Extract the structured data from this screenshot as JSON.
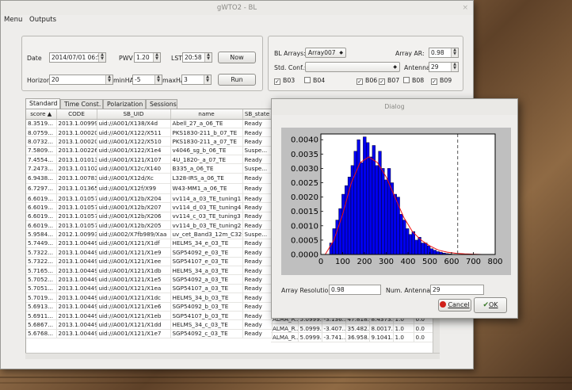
{
  "window": {
    "title": "gWTO2 - BL",
    "close": "×"
  },
  "menu": [
    "Menu",
    "Outputs"
  ],
  "params": {
    "date_label": "Date",
    "date_value": "2014/07/01 06:52",
    "pwv_label": "PWV",
    "pwv_value": "1.20",
    "lst_label": "LST",
    "lst_value": "20:58",
    "now_button": "Now",
    "horizon_label": "Horizon",
    "horizon_value": "20",
    "minha_label": "minHA",
    "minha_value": "-5",
    "maxha_label": "maxHA",
    "maxha_value": "3",
    "run_button": "Run"
  },
  "arrays": {
    "bl_arrays_label": "BL Arrays:",
    "bl_arrays_value": "Array007",
    "array_ar_label": "Array AR:",
    "array_ar_value": "0.98",
    "std_conf_label": "Std. Conf.:",
    "std_conf_value": "",
    "antennas_label": "Antennas:",
    "antennas_value": "29",
    "bands": [
      {
        "label": "B03",
        "checked": true
      },
      {
        "label": "B04",
        "checked": false
      },
      {
        "label": "B06",
        "checked": true
      },
      {
        "label": "B07",
        "checked": true
      },
      {
        "label": "B08",
        "checked": false
      },
      {
        "label": "B09",
        "checked": true
      }
    ]
  },
  "tabs": [
    "Standard",
    "Time Const.",
    "Polarization",
    "Sessions"
  ],
  "table": {
    "headers": [
      "score ▲",
      "CODE",
      "SB_UID",
      "name",
      "SB_state"
    ],
    "rows": [
      [
        "8.3519...",
        "2013.1.00999.S",
        "uid://A001/X138/X4d",
        "Abell_27_a_06_TE",
        "Ready"
      ],
      [
        "8.0759...",
        "2013.1.00020.S",
        "uid://A001/X122/X511",
        "PKS1830-211_b_07_TE",
        "Ready"
      ],
      [
        "8.0732...",
        "2013.1.00020.S",
        "uid://A001/X122/X510",
        "PKS1830-211_a_07_TE",
        "Ready"
      ],
      [
        "7.5809...",
        "2013.1.00226.S",
        "uid://A001/X122/X1e4",
        "v4046_sg_b_06_TE",
        "Suspe..."
      ],
      [
        "7.4554...",
        "2013.1.01013.S",
        "uid://A001/X121/X107",
        "4U_1820-_a_07_TE",
        "Ready"
      ],
      [
        "7.2473...",
        "2013.1.01102.S",
        "uid://A001/X12c/X140",
        "B335_a_06_TE",
        "Suspe..."
      ],
      [
        "6.9438...",
        "2013.1.00783.S",
        "uid://A001/X12d/Xc",
        "L328-IRS_a_06_TE",
        "Ready"
      ],
      [
        "6.7297...",
        "2013.1.01365.S",
        "uid://A001/X12f/X99",
        "W43-MM1_a_06_TE",
        "Ready"
      ],
      [
        "6.6019...",
        "2013.1.01057.S",
        "uid://A001/X12b/X204",
        "vv114_a_03_TE_tuning1",
        "Ready"
      ],
      [
        "6.6019...",
        "2013.1.01057.S",
        "uid://A001/X12b/X207",
        "vv114_d_03_TE_tuning4",
        "Ready"
      ],
      [
        "6.6019...",
        "2013.1.01057.S",
        "uid://A001/X12b/X206",
        "vv114_c_03_TE_tuning3",
        "Ready"
      ],
      [
        "6.6019...",
        "2013.1.01057.S",
        "uid://A001/X12b/X205",
        "vv114_b_03_TE_tuning2",
        "Ready"
      ],
      [
        "5.9584...",
        "2012.1.00993.S",
        "uid://A002/X7fb989/Xaa",
        "uv_cet_Band3_12m_C32-5",
        "Suspe..."
      ],
      [
        "5.7449...",
        "2013.1.00449.S",
        "uid://A001/X121/X1df",
        "HELMS_34_e_03_TE",
        "Ready"
      ],
      [
        "5.7322...",
        "2013.1.00449.S",
        "uid://A001/X121/X1e9",
        "SGP54092_e_03_TE",
        "Ready"
      ],
      [
        "5.7322...",
        "2013.1.00449.S",
        "uid://A001/X121/X1ee",
        "SGP54107_e_03_TE",
        "Ready"
      ],
      [
        "5.7165...",
        "2013.1.00449.S",
        "uid://A001/X121/X1db",
        "HELMS_34_a_03_TE",
        "Ready"
      ],
      [
        "5.7052...",
        "2013.1.00449.S",
        "uid://A001/X121/X1e5",
        "SGP54092_a_03_TE",
        "Ready"
      ],
      [
        "5.7051...",
        "2013.1.00449.S",
        "uid://A001/X121/X1ea",
        "SGP54107_a_03_TE",
        "Ready"
      ],
      [
        "5.7019...",
        "2013.1.00449.S",
        "uid://A001/X121/X1dc",
        "HELMS_34_b_03_TE",
        "Ready"
      ],
      [
        "5.6913...",
        "2013.1.00449.S",
        "uid://A001/X121/X1e6",
        "SGP54092_b_03_TE",
        "Ready"
      ],
      [
        "5.6911...",
        "2013.1.00449.S",
        "uid://A001/X121/X1eb",
        "SGP54107_b_03_TE",
        "Ready"
      ],
      [
        "5.6867...",
        "2013.1.00449.S",
        "uid://A001/X121/X1dd",
        "HELMS_34_c_03_TE",
        "Ready"
      ],
      [
        "5.6768...",
        "2013.1.00449.S",
        "uid://A001/X121/X1e7",
        "SGP54092_c_03_TE",
        "Ready"
      ]
    ],
    "extra_cols": [
      [
        "ALMA_R...",
        "5.0999...",
        "-3.136...",
        "47.818...",
        "8.4373...",
        "1.0",
        "0.0"
      ],
      [
        "ALMA_R...",
        "5.0999...",
        "-3.407...",
        "35.482...",
        "8.0017...",
        "1.0",
        "0.0"
      ],
      [
        "ALMA_R...",
        "5.0999...",
        "-3.741...",
        "36.958...",
        "9.1041...",
        "1.0",
        "0.0"
      ]
    ]
  },
  "dialog": {
    "title": "Dialog",
    "array_resolution_label": "Array Resolution",
    "array_resolution_value": "0.98",
    "num_antennas_label": "Num. Antennas",
    "num_antennas_value": "29",
    "cancel_button": "Cancel",
    "ok_button": "OK",
    "cancel_icon_color": "#d0201a"
  },
  "chart_data": {
    "type": "bar",
    "bar_color": "#0000ee",
    "curve_color": "#ee1111",
    "xlim": [
      0,
      800
    ],
    "ylim": [
      0,
      0.0042
    ],
    "xticks": [
      "0",
      "100",
      "200",
      "300",
      "400",
      "500",
      "600",
      "700",
      "800"
    ],
    "yticks": [
      "0.0000",
      "0.0005",
      "0.0010",
      "0.0015",
      "0.0020",
      "0.0025",
      "0.0030",
      "0.0035",
      "0.0040"
    ],
    "bin_width": 14,
    "bin_starts": [
      40,
      54,
      68,
      82,
      96,
      110,
      124,
      138,
      152,
      166,
      180,
      194,
      208,
      222,
      236,
      250,
      264,
      278,
      292,
      306,
      320,
      334,
      348,
      362,
      376,
      390,
      404,
      418,
      432,
      446,
      460,
      474,
      488,
      502,
      516,
      530,
      544,
      558,
      572,
      586,
      600,
      614,
      628
    ],
    "values": [
      0.0004,
      0.0009,
      0.0012,
      0.0016,
      0.0021,
      0.0024,
      0.0027,
      0.0031,
      0.0036,
      0.004,
      0.0032,
      0.0041,
      0.0039,
      0.0034,
      0.0038,
      0.0031,
      0.0036,
      0.003,
      0.0026,
      0.003,
      0.0025,
      0.0021,
      0.002,
      0.0014,
      0.0012,
      0.0009,
      0.0007,
      0.0008,
      0.0005,
      0.0006,
      0.0004,
      0.0004,
      0.0003,
      0.0002,
      0.00015,
      0.0001,
      8e-05,
      5e-05,
      3e-05,
      2e-05,
      1e-05,
      1e-05,
      1e-05
    ],
    "curve_x": [
      20,
      60,
      100,
      140,
      180,
      220,
      260,
      300,
      340,
      380,
      420,
      460,
      500,
      540,
      580,
      620,
      660,
      700,
      740,
      780,
      800
    ],
    "curve_y": [
      0.0,
      0.0005,
      0.0014,
      0.0025,
      0.0032,
      0.0034,
      0.0032,
      0.0027,
      0.002,
      0.0013,
      0.0008,
      0.0005,
      0.0003,
      0.00015,
      8e-05,
      4e-05,
      2e-05,
      1e-05,
      0.0,
      0.0,
      0.0
    ],
    "vline_x": 628
  }
}
